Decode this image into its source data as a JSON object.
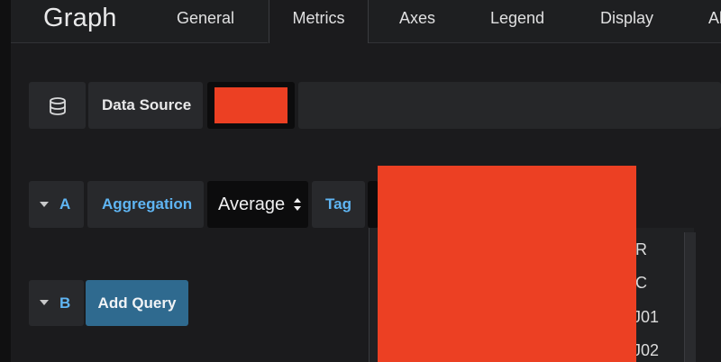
{
  "panel": {
    "title": "Graph"
  },
  "tabs": [
    {
      "label": "General"
    },
    {
      "label": "Metrics"
    },
    {
      "label": "Axes"
    },
    {
      "label": "Legend"
    },
    {
      "label": "Display"
    },
    {
      "label": "Al"
    }
  ],
  "active_tab": "Metrics",
  "data_source": {
    "label": "Data Source",
    "icon": "database-icon"
  },
  "query_a": {
    "ref": "A",
    "aggregation_label": "Aggregation",
    "aggregation_value": "Average",
    "tag_label": "Tag"
  },
  "query_b": {
    "ref": "B",
    "add_query_label": "Add Query"
  },
  "dropdown": {
    "items": [
      "R",
      "C",
      "J01",
      "J02"
    ]
  },
  "colors": {
    "accent": "#5fb5f3",
    "redaction": "#ec4023",
    "button": "#2f6a8f"
  }
}
